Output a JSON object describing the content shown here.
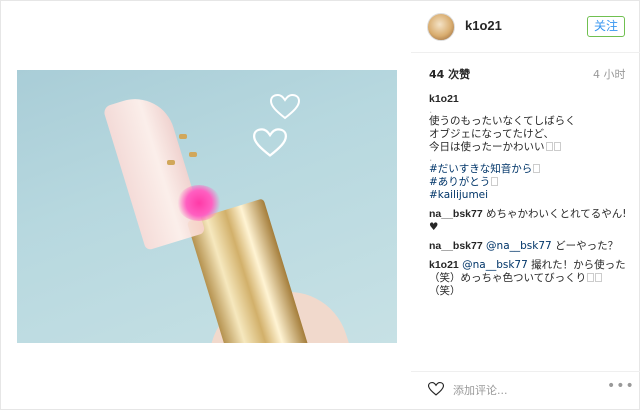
{
  "post": {
    "username": "k1o21",
    "follow_label": "关注",
    "likes": "44 次赞",
    "time": "4 小时"
  },
  "caption": {
    "user": "k1o21",
    "dot": ".",
    "lines": [
      "使うのもったいなくてしばらく",
      "オブジェになってたけど、",
      "今日は使ったーかわいい"
    ],
    "dot2": ".",
    "tags": [
      "#だいすきな知音から",
      "#ありがとう",
      "#kailijumei"
    ]
  },
  "comments": [
    {
      "user": "na__bsk77",
      "text": " めちゃかわいくとれてるやん!♥"
    },
    {
      "user": "na__bsk77",
      "mention": " @na__bsk77",
      "text": " どーやった？"
    },
    {
      "user": "k1o21",
      "mention": " @na__bsk77",
      "text": " 撮れた！から使った（笑）めっちゃ色ついてびっくり",
      "text2": "（笑）"
    }
  ],
  "footer": {
    "add_comment_placeholder": "添加评论...",
    "more_label": "•••"
  },
  "icons": {
    "like": "heart-outline-icon",
    "more": "more-options-icon"
  },
  "colors": {
    "follow_border": "#70c050",
    "follow_text": "#3897f0",
    "hashtag": "#003569"
  }
}
